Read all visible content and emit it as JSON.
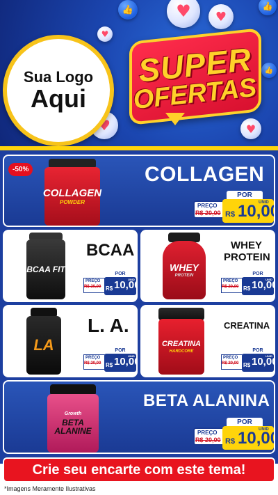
{
  "header": {
    "logo_line1": "Sua Logo",
    "logo_line2": "Aqui",
    "promo_line1": "SUPER",
    "promo_line2": "OFERTAS"
  },
  "products": [
    {
      "name": "COLLAGEN",
      "discount_badge": "-50%",
      "jar_text": "COLLAGEN",
      "jar_subtext": "POWDER",
      "price": {
        "por_label": "POR",
        "preco_label": "PREÇO",
        "old_price": "R$ 20,00",
        "currency": "R$",
        "value": "10,00",
        "unit": "UNID"
      }
    },
    {
      "name": "BCAA",
      "jar_text": "BCAA FIT",
      "price": {
        "por_label": "POR",
        "preco_label": "PREÇO",
        "old_price": "R$ 20,00",
        "currency": "R$",
        "value": "10,00",
        "unit": "UNID"
      }
    },
    {
      "name_line1": "WHEY",
      "name_line2": "PROTEIN",
      "jar_text": "WHEY",
      "jar_subtext": "PROTEIN",
      "price": {
        "por_label": "POR",
        "preco_label": "PREÇO",
        "old_price": "R$ 20,00",
        "currency": "R$",
        "value": "10,00",
        "unit": "UNID"
      }
    },
    {
      "name": "L. A.",
      "jar_text": "LA",
      "price": {
        "por_label": "POR",
        "preco_label": "PREÇO",
        "old_price": "R$ 20,00",
        "currency": "R$",
        "value": "10,00",
        "unit": "UNID"
      }
    },
    {
      "name": "CREATINA",
      "jar_text": "CREATINA",
      "jar_subtext": "HARDCORE",
      "price": {
        "por_label": "POR",
        "preco_label": "PREÇO",
        "old_price": "R$ 20,00",
        "currency": "R$",
        "value": "10,00",
        "unit": "UNID"
      }
    },
    {
      "name": "BETA ALANINA",
      "jar_text": "BETA ALANINE",
      "jar_brand": "Growth",
      "price": {
        "por_label": "POR",
        "preco_label": "PREÇO",
        "old_price": "R$ 20,00",
        "currency": "R$",
        "value": "10,00",
        "unit": "UNID"
      }
    }
  ],
  "cta": {
    "label": "Crie seu encarte com este tema!"
  },
  "footnote": "*Imagens Meramente Ilustrativas",
  "icons": [
    "heart-icon",
    "like-icon"
  ],
  "colors": {
    "primary_blue": "#1a3a94",
    "accent_yellow": "#ffd40a",
    "accent_red": "#e8141f"
  }
}
